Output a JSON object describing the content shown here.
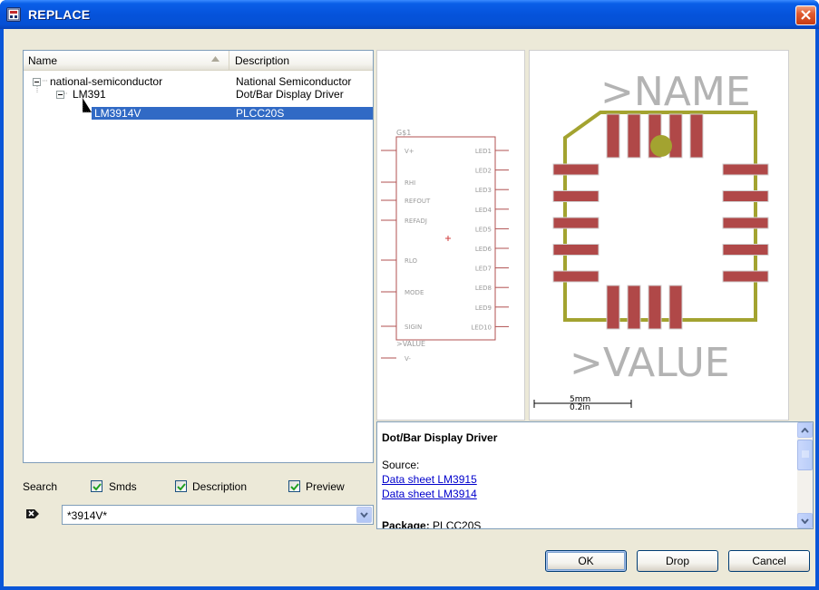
{
  "window": {
    "title": "REPLACE"
  },
  "tree": {
    "columns": {
      "name": "Name",
      "description": "Description"
    },
    "rows": [
      {
        "name": "national-semiconductor",
        "description": "National Semiconductor"
      },
      {
        "name": "LM391",
        "description": "Dot/Bar Display Driver"
      },
      {
        "name": "LM3914V",
        "description": "PLCC20S"
      }
    ],
    "selected_row": "LM3914V"
  },
  "search": {
    "label": "Search",
    "options": [
      {
        "label": "Smds",
        "checked": true
      },
      {
        "label": "Description",
        "checked": true
      },
      {
        "label": "Preview",
        "checked": true
      }
    ],
    "value": "*3914V*"
  },
  "symbol_preview": {
    "part_label": "G$1",
    "value_label": ">VALUE",
    "pins_left": [
      "V+",
      "RHI",
      "REFOUT",
      "REFADJ",
      "RLO",
      "MODE",
      "SIGIN",
      "V-"
    ],
    "pins_right": [
      "LED1",
      "LED2",
      "LED3",
      "LED4",
      "LED5",
      "LED6",
      "LED7",
      "LED8",
      "LED9",
      "LED10"
    ]
  },
  "package_preview": {
    "name_label": ">NAME",
    "value_label": ">VALUE",
    "scale_mm": "5mm",
    "scale_in": "0.2in",
    "colors": {
      "outline": "#a3a330",
      "pad": "#b04848",
      "text": "#b3b3b3"
    }
  },
  "info": {
    "title": "Dot/Bar Display Driver",
    "source_label": "Source:",
    "links": [
      "Data sheet LM3915",
      "Data sheet LM3914 "
    ],
    "package_label": "Package:",
    "package_value": "PLCC20S"
  },
  "buttons": {
    "ok": "OK",
    "drop": "Drop",
    "cancel": "Cancel"
  }
}
